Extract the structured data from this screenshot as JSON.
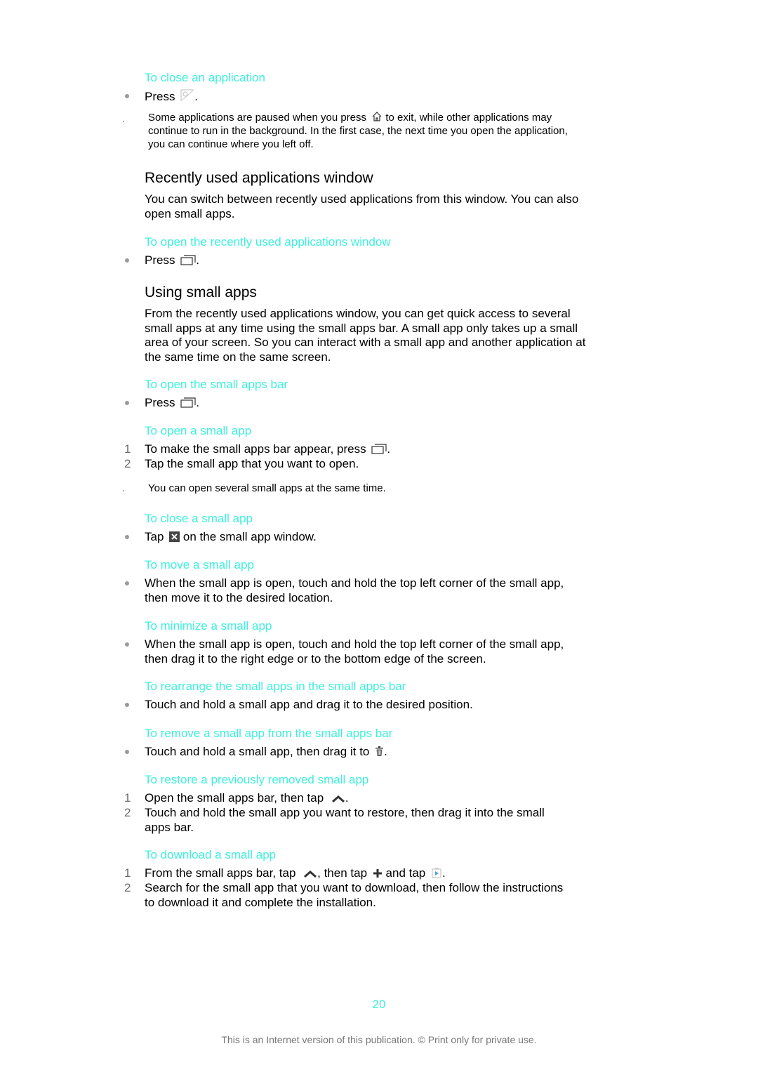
{
  "sections": {
    "close_app": {
      "title": "To close an application",
      "step": "Press",
      "note_lines": [
        "Some applications are paused when you press",
        "to exit, while other applications may",
        "continue to run in the background. In the first case, the next time you open the application,",
        "you can continue where you left off."
      ]
    },
    "recent_window": {
      "heading": "Recently used applications window",
      "body_lines": [
        "You can switch between recently used applications from this window. You can also",
        "open small apps."
      ]
    },
    "open_recent": {
      "title": "To open the recently used applications window",
      "step": "Press"
    },
    "small_apps": {
      "heading": "Using small apps",
      "body_lines": [
        "From the recently used applications window, you can get quick access to several",
        "small apps at any time using the small apps bar. A small app only takes up a small",
        "area of your screen. So you can interact with a small app and another application at",
        "the same time on the same screen."
      ]
    },
    "open_bar": {
      "title": "To open the small apps bar",
      "step": "Press"
    },
    "open_small_app": {
      "title": "To open a small app",
      "steps": [
        {
          "num": "1",
          "text": "To make the small apps bar appear, press"
        },
        {
          "num": "2",
          "text": "Tap the small app that you want to open."
        }
      ],
      "note": "You can open several small apps at the same time."
    },
    "close_small_app": {
      "title": "To close a small app",
      "step_pre": "Tap",
      "step_post": "on the small app window."
    },
    "move_small_app": {
      "title": "To move a small app",
      "lines": [
        "When the small app is open, touch and hold the top left corner of the small app,",
        "then move it to the desired location."
      ]
    },
    "minimize_small_app": {
      "title": "To minimize a small app",
      "lines": [
        "When the small app is open, touch and hold the top left corner of the small app,",
        "then drag it to the right edge or to the bottom edge of the screen."
      ]
    },
    "rearrange": {
      "title": "To rearrange the small apps in the small apps bar",
      "step": "Touch and hold a small app and drag it to the desired position."
    },
    "remove": {
      "title": "To remove a small app from the small apps bar",
      "step": "Touch and hold a small app, then drag it to"
    },
    "restore": {
      "title": "To restore a previously removed small app",
      "steps": [
        {
          "num": "1",
          "text": "Open the small apps bar, then tap"
        },
        {
          "num": "2",
          "lines": [
            "Touch and hold the small app you want to restore, then drag it into the small",
            "apps bar."
          ]
        }
      ]
    },
    "download": {
      "title": "To download a small app",
      "steps": [
        {
          "num": "1",
          "a": "From the small apps bar, tap",
          "b": ", then tap",
          "c": "and tap"
        },
        {
          "num": "2",
          "lines": [
            "Search for the small app that you want to download, then follow the instructions",
            "to download it and complete the installation."
          ]
        }
      ]
    }
  },
  "footer": {
    "page_number": "20",
    "notice": "This is an Internet version of this publication. © Print only for private use."
  },
  "colors": {
    "accent": "#3ef0dc"
  }
}
